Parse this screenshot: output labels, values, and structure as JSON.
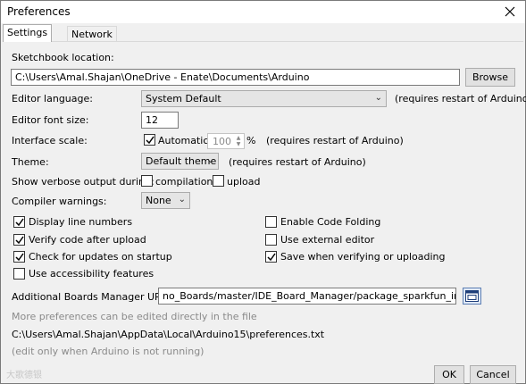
{
  "window": {
    "title": "Preferences",
    "close_glyph": "✕"
  },
  "tabs": [
    {
      "label": "Settings",
      "active": true
    },
    {
      "label": "Network",
      "active": false
    }
  ],
  "sketchbook": {
    "label": "Sketchbook location:",
    "value": "C:\\Users\\Amal.Shajan\\OneDrive - Enate\\Documents\\Arduino",
    "browse_label": "Browse"
  },
  "editor_language": {
    "label": "Editor language:",
    "selected": "System Default",
    "note": "(requires restart of Arduino)"
  },
  "font_size": {
    "label": "Editor font size:",
    "value": "12"
  },
  "interface_scale": {
    "label": "Interface scale:",
    "automatic_label": "Automatic",
    "automatic_checked": true,
    "value": "100",
    "unit": "%",
    "note": "(requires restart of Arduino)"
  },
  "theme": {
    "label": "Theme:",
    "selected": "Default theme",
    "note": "(requires restart of Arduino)"
  },
  "verbose": {
    "label": "Show verbose output during:",
    "compilation_label": "compilation",
    "compilation_checked": false,
    "upload_label": "upload",
    "upload_checked": false
  },
  "compiler_warnings": {
    "label": "Compiler warnings:",
    "selected": "None"
  },
  "options_left": [
    {
      "label": "Display line numbers",
      "checked": true
    },
    {
      "label": "Verify code after upload",
      "checked": true
    },
    {
      "label": "Check for updates on startup",
      "checked": true
    },
    {
      "label": "Use accessibility features",
      "checked": false
    }
  ],
  "options_right": [
    {
      "label": "Enable Code Folding",
      "checked": false
    },
    {
      "label": "Use external editor",
      "checked": false
    },
    {
      "label": "Save when verifying or uploading",
      "checked": true
    }
  ],
  "boards_manager": {
    "label": "Additional Boards Manager URLs:",
    "value": "no_Boards/master/IDE_Board_Manager/package_sparkfun_index.json"
  },
  "footer_info": {
    "line1": "More preferences can be edited directly in the file",
    "path": "C:\\Users\\Amal.Shajan\\AppData\\Local\\Arduino15\\preferences.txt",
    "line3": "(edit only when Arduino is not running)"
  },
  "buttons": {
    "ok": "OK",
    "cancel": "Cancel"
  },
  "watermark": "大歌德银"
}
